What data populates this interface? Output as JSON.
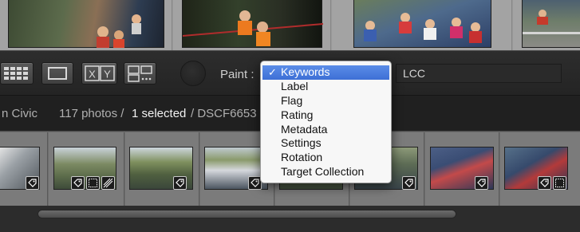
{
  "toolbar": {
    "view_buttons": [
      {
        "name": "grid-view-button",
        "icon": "grid-icon"
      },
      {
        "name": "loupe-view-button",
        "icon": "loupe-icon"
      },
      {
        "name": "compare-view-button",
        "icon": "compare-xy-icon"
      },
      {
        "name": "survey-view-button",
        "icon": "survey-icon"
      }
    ],
    "paint_label": "Paint :",
    "paint_value": "LCC"
  },
  "paint_menu": {
    "checkmark": "✓",
    "items": [
      "Keywords",
      "Label",
      "Flag",
      "Rating",
      "Metadata",
      "Settings",
      "Rotation",
      "Target Collection"
    ],
    "selected_index": 0
  },
  "info_bar": {
    "source": "n Civic",
    "photo_count": "117 photos /",
    "selected": "1 selected",
    "file": "/ DSCF6653"
  },
  "colors": {
    "menu_highlight": "#3d6fd6",
    "toolbar_bg": "#242424",
    "filmstrip_bg": "#7b7b7b"
  }
}
